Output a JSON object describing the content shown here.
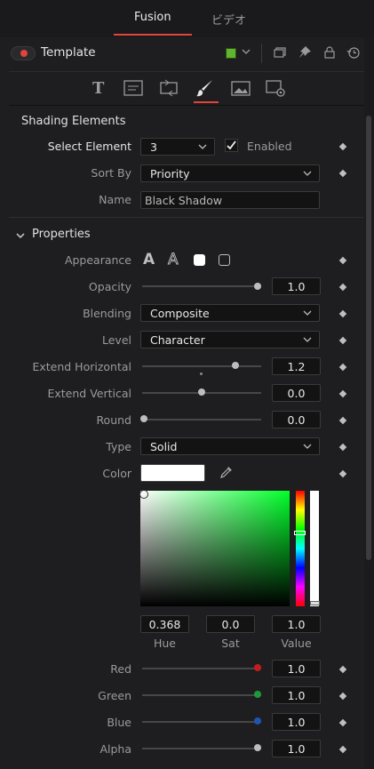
{
  "tabs": [
    {
      "label": "Fusion"
    },
    {
      "label": "ビデオ"
    }
  ],
  "template": {
    "title": "Template"
  },
  "icons": {
    "tool_tabs": [
      "text-icon",
      "layout-icon",
      "transform-icon",
      "shading-icon",
      "image-icon",
      "settings-icon"
    ],
    "header": [
      "snapshot-icon",
      "pin-icon",
      "lock-icon",
      "reset-icon"
    ]
  },
  "shading": {
    "heading": "Shading Elements",
    "select_label": "Select Element",
    "select_value": "3",
    "enabled_label": "Enabled",
    "sort_label": "Sort By",
    "sort_value": "Priority",
    "name_label": "Name",
    "name_value": "Black Shadow"
  },
  "properties": {
    "heading": "Properties",
    "appearance_label": "Appearance",
    "opacity_label": "Opacity",
    "opacity_value": "1.0",
    "blending_label": "Blending",
    "blending_value": "Composite",
    "level_label": "Level",
    "level_value": "Character",
    "extend_h_label": "Extend Horizontal",
    "extend_h_value": "1.2",
    "extend_v_label": "Extend Vertical",
    "extend_v_value": "0.0",
    "round_label": "Round",
    "round_value": "0.0",
    "type_label": "Type",
    "type_value": "Solid",
    "color_label": "Color"
  },
  "color_picker": {
    "hue_value": "0.368",
    "sat_value": "0.0",
    "val_value": "1.0",
    "hue_label": "Hue",
    "sat_label": "Sat",
    "val_label": "Value"
  },
  "channels": {
    "red_label": "Red",
    "red_value": "1.0",
    "green_label": "Green",
    "green_value": "1.0",
    "blue_label": "Blue",
    "blue_value": "1.0",
    "alpha_label": "Alpha",
    "alpha_value": "1.0"
  },
  "colors": {
    "accent": "#e0443a",
    "swatch": "#ffffff",
    "red_dot": "#c41c1c",
    "green_dot": "#1c9a3a",
    "blue_dot": "#1f54b0",
    "alpha_dot": "#bdbdbd"
  }
}
